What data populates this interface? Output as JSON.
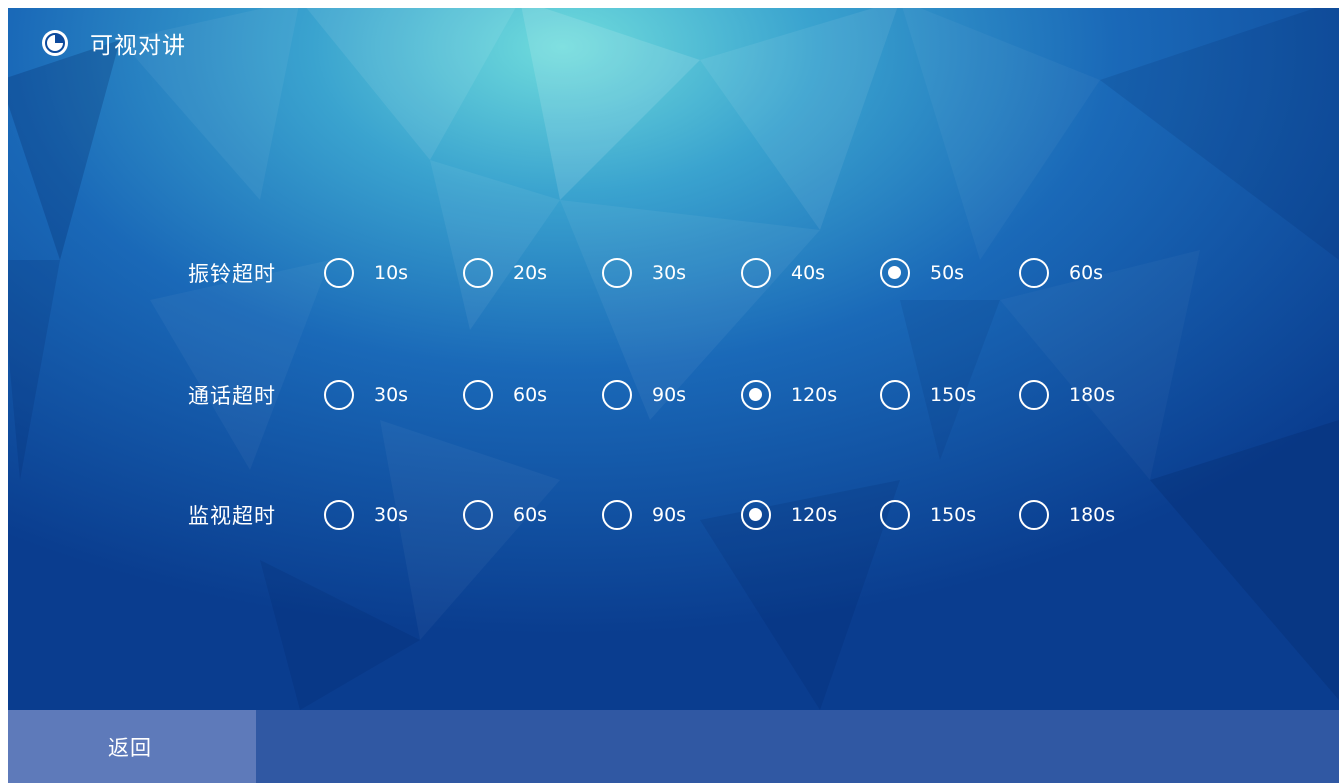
{
  "header": {
    "title": "可视对讲",
    "icon": "timer-icon"
  },
  "settings": [
    {
      "key": "ring",
      "label": "振铃超时",
      "options": [
        "10s",
        "20s",
        "30s",
        "40s",
        "50s",
        "60s"
      ],
      "selected": 4
    },
    {
      "key": "call",
      "label": "通话超时",
      "options": [
        "30s",
        "60s",
        "90s",
        "120s",
        "150s",
        "180s"
      ],
      "selected": 3
    },
    {
      "key": "monitor",
      "label": "监视超时",
      "options": [
        "30s",
        "60s",
        "90s",
        "120s",
        "150s",
        "180s"
      ],
      "selected": 3
    }
  ],
  "footer": {
    "back_label": "返回"
  },
  "colors": {
    "accent": "#ffffff",
    "background_dark": "#0a3d8f",
    "background_light": "#6fd6da"
  }
}
